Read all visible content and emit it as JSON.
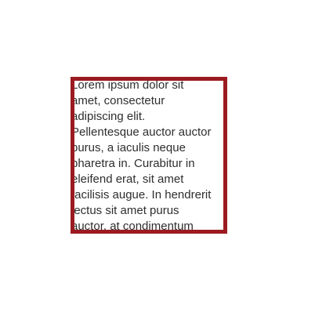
{
  "colors": {
    "border": "#9b1b21",
    "text": "#2e2e2e",
    "background": "#ffffff"
  },
  "box": {
    "lines": [
      "Lorem ipsum dolor sit",
      "amet, consectetur",
      "adipiscing elit.",
      "Pellentesque auctor auctor",
      "purus, a iaculis neque",
      "pharetra in. Curabitur in",
      "eleifend erat, sit amet",
      "facilisis augue. In hendrerit",
      "lectus sit amet purus",
      "auctor, at condimentum"
    ]
  }
}
